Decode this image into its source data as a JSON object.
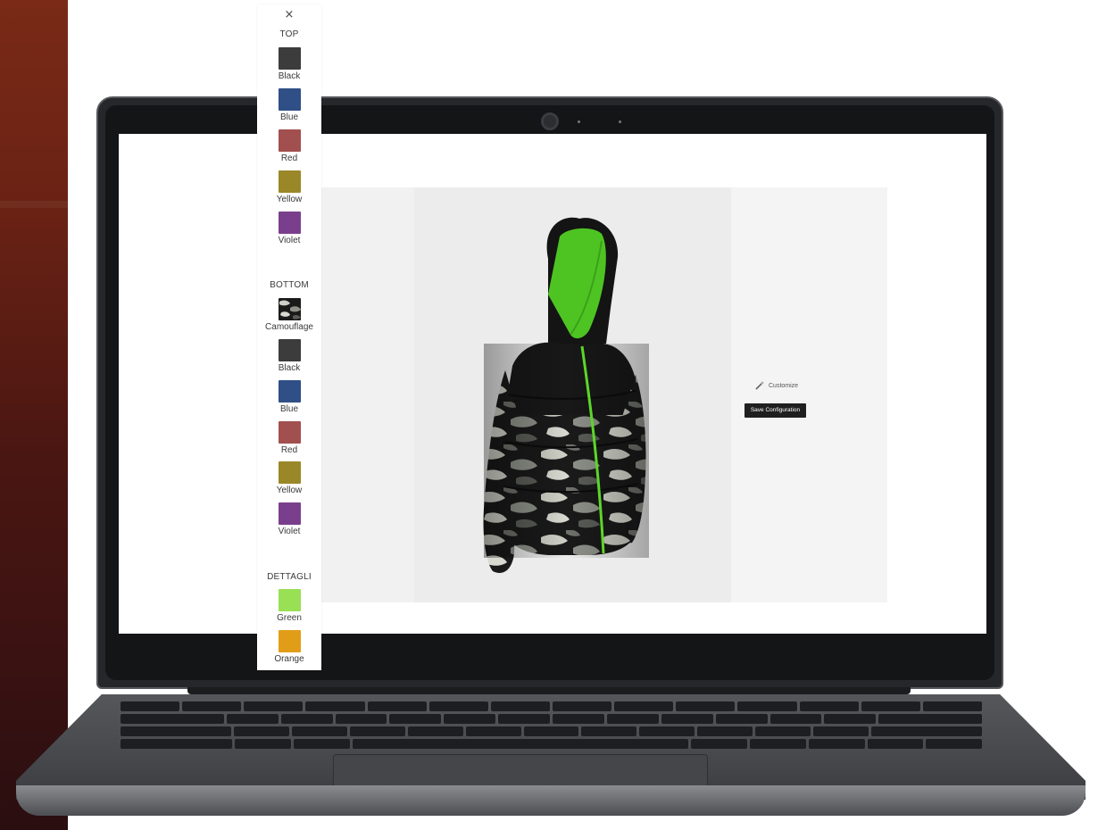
{
  "configurator": {
    "close_glyph": "×",
    "sections": [
      {
        "title": "TOP",
        "options": [
          {
            "label": "Black",
            "color": "#3c3c3c"
          },
          {
            "label": "Blue",
            "color": "#2f4f86"
          },
          {
            "label": "Red",
            "color": "#a24f4f"
          },
          {
            "label": "Yellow",
            "color": "#9a8728"
          },
          {
            "label": "Violet",
            "color": "#7a3f8c"
          }
        ]
      },
      {
        "title": "BOTTOM",
        "options": [
          {
            "label": "Camouflage",
            "color": "#2b2b2b",
            "pattern": "camouflage"
          },
          {
            "label": "Black",
            "color": "#3c3c3c"
          },
          {
            "label": "Blue",
            "color": "#2f4f86"
          },
          {
            "label": "Red",
            "color": "#a24f4f"
          },
          {
            "label": "Yellow",
            "color": "#9a8728"
          },
          {
            "label": "Violet",
            "color": "#7a3f8c"
          }
        ]
      },
      {
        "title": "DETTAGLI",
        "options": [
          {
            "label": "Green",
            "color": "#99e055"
          },
          {
            "label": "Orange",
            "color": "#e29d18"
          }
        ]
      }
    ],
    "customize_label": "Customize",
    "customize_icon": "magic-wand-icon",
    "save_label": "Save Configuration"
  },
  "colors": {
    "brand_strip": "#6a2214",
    "jacket_body": "#151515",
    "jacket_lining": "#4ec423",
    "zipper": "#5cd62a"
  }
}
